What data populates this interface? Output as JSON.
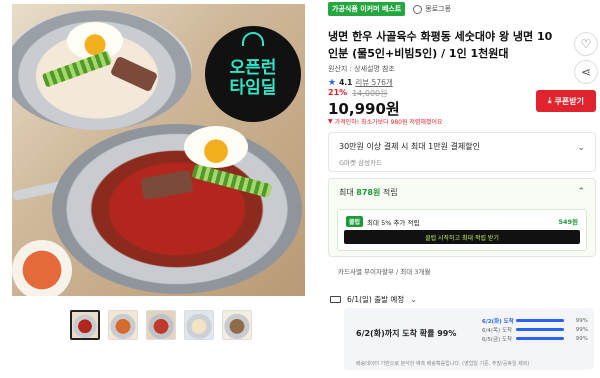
{
  "image": {
    "badge_line1": "오픈런",
    "badge_line2": "타임딜"
  },
  "thumbnails": [
    {
      "name": "thumb-1",
      "active": true
    },
    {
      "name": "thumb-2",
      "active": false
    },
    {
      "name": "thumb-3",
      "active": false
    },
    {
      "name": "thumb-4",
      "active": false
    },
    {
      "name": "thumb-5",
      "active": false
    }
  ],
  "product": {
    "tag": "가공식품 이커머 베스트",
    "shop_link": "몽로그몽",
    "title": "냉면 한우 사골육수 화평동 세숫대야 왕 냉면 10인분 (물5인+비빔5인) / 1인 1천원대",
    "origin": "원산지 : 상세설명 참조",
    "rating": "4.1",
    "reviews": "리뷰 576개",
    "discount": "21%",
    "original_price": "14,000원",
    "price": "10,990원",
    "coupon_label": "쿠폰받기",
    "price_note": "가격인하! 최소가보다 980원 저렴해졌어요"
  },
  "card_benefit": {
    "line1": "30만원 이상 결제 시 최대 1만원 결제할인",
    "line2": "G마켓 삼성카드"
  },
  "points": {
    "head_prefix": "최대",
    "head_amount": "878원",
    "head_suffix": "적립",
    "club_badge": "클럽",
    "club_text": "최대 5% 추가 적립",
    "club_amount": "549원",
    "club_button": "클럽 시작하고 최대 적립 받기"
  },
  "installment": "카드사별 무이자할부 / 최대 3개월",
  "shipping": {
    "head": "6/1(일) 출발 예정",
    "arrival_main": "6/2(화)까지 도착 확률 99%",
    "rows": [
      {
        "day": "6/2(화) 도착",
        "pct": "99%",
        "value": 0.99,
        "highlight": true
      },
      {
        "day": "6/4(목) 도착",
        "pct": "99%",
        "value": 0.99,
        "highlight": false
      },
      {
        "day": "6/5(금) 도착",
        "pct": "99%",
        "value": 0.99,
        "highlight": false
      }
    ],
    "note": "배송데이터 기반으로 분석한 예측 배송확률입니다. (영업일 기준, 주말/공휴일 제외)"
  },
  "colors": {
    "accent_red": "#e1232e",
    "accent_green": "#1f9a3a",
    "accent_blue": "#2a62f0"
  }
}
